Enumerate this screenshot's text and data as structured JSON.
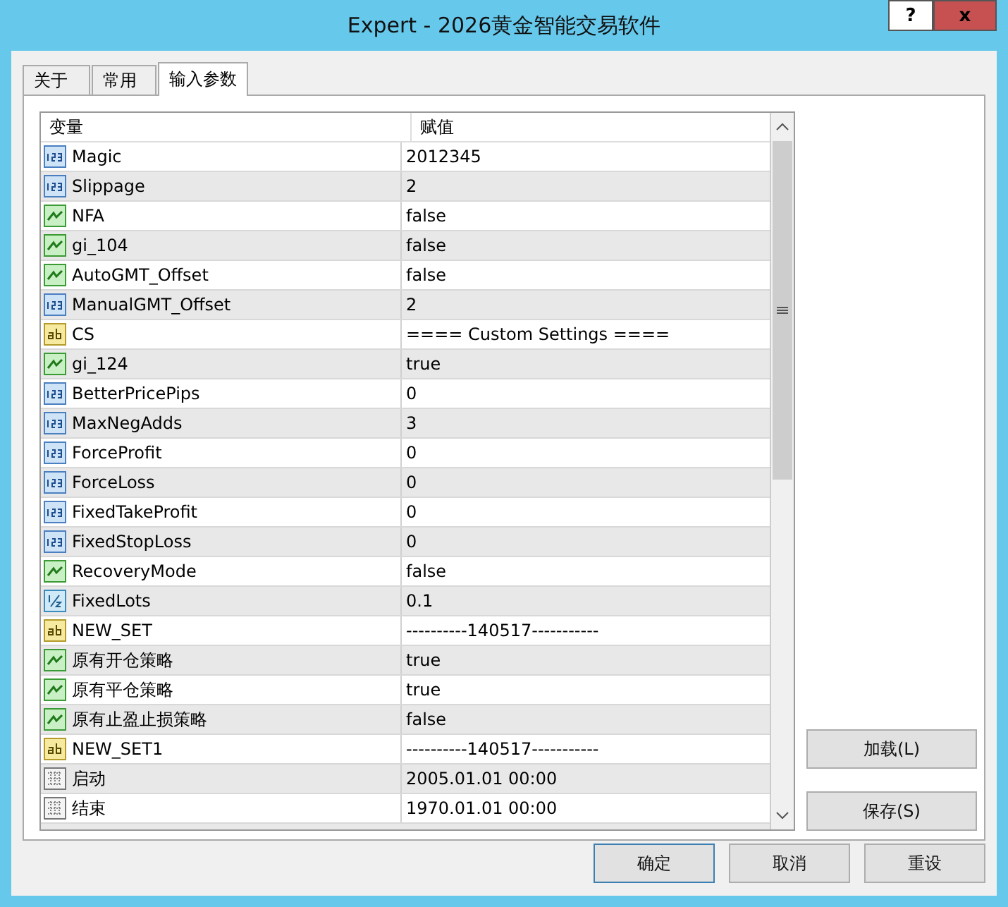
{
  "window": {
    "title": "Expert - 2026黄金智能交易软件",
    "help_button": "?",
    "close_button": "x"
  },
  "tabs": [
    {
      "label": "关于",
      "selected": false
    },
    {
      "label": "常用",
      "selected": false
    },
    {
      "label": "输入参数",
      "selected": true
    }
  ],
  "table": {
    "columns": [
      "变量",
      "赋值"
    ],
    "rows": [
      {
        "kind": "int",
        "name": "Magic",
        "value": "2012345"
      },
      {
        "kind": "int",
        "name": "Slippage",
        "value": "2"
      },
      {
        "kind": "bool",
        "name": "NFA",
        "value": "false"
      },
      {
        "kind": "bool",
        "name": "gi_104",
        "value": "false"
      },
      {
        "kind": "bool",
        "name": "AutoGMT_Offset",
        "value": "false"
      },
      {
        "kind": "int",
        "name": "ManualGMT_Offset",
        "value": "2"
      },
      {
        "kind": "string",
        "name": "CS",
        "value": "==== Custom Settings ===="
      },
      {
        "kind": "bool",
        "name": "gi_124",
        "value": "true"
      },
      {
        "kind": "int",
        "name": "BetterPricePips",
        "value": "0"
      },
      {
        "kind": "int",
        "name": "MaxNegAdds",
        "value": "3"
      },
      {
        "kind": "int",
        "name": "ForceProfit",
        "value": "0"
      },
      {
        "kind": "int",
        "name": "ForceLoss",
        "value": "0"
      },
      {
        "kind": "int",
        "name": "FixedTakeProfit",
        "value": "0"
      },
      {
        "kind": "int",
        "name": "FixedStopLoss",
        "value": "0"
      },
      {
        "kind": "bool",
        "name": "RecoveryMode",
        "value": "false"
      },
      {
        "kind": "double",
        "name": "FixedLots",
        "value": "0.1"
      },
      {
        "kind": "string",
        "name": "NEW_SET",
        "value": "----------140517-----------"
      },
      {
        "kind": "bool",
        "name": "原有开仓策略",
        "value": "true"
      },
      {
        "kind": "bool",
        "name": "原有平仓策略",
        "value": "true"
      },
      {
        "kind": "bool",
        "name": "原有止盈止损策略",
        "value": "false"
      },
      {
        "kind": "string",
        "name": "NEW_SET1",
        "value": "----------140517-----------"
      },
      {
        "kind": "datetime",
        "name": "启动",
        "value": "2005.01.01 00:00"
      },
      {
        "kind": "datetime",
        "name": "结束",
        "value": "1970.01.01 00:00"
      }
    ]
  },
  "side_buttons": [
    "加载(L)",
    "保存(S)"
  ],
  "buttons": [
    {
      "label": "确定",
      "default": true
    },
    {
      "label": "取消",
      "default": false
    },
    {
      "label": "重设",
      "default": false
    }
  ]
}
